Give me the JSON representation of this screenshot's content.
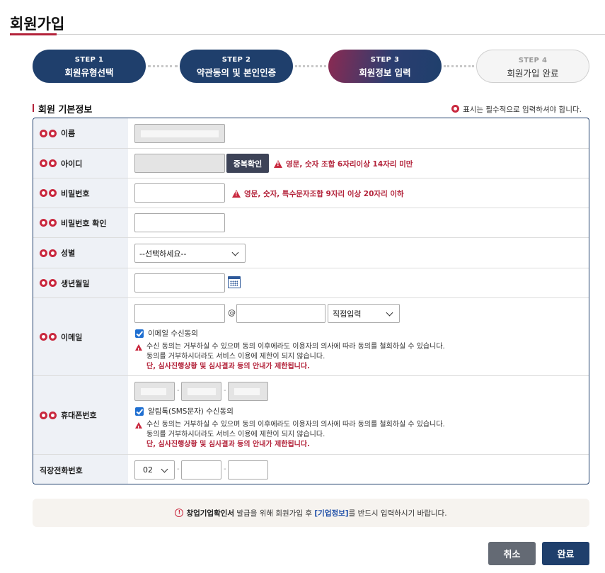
{
  "page": {
    "title": "회원가입"
  },
  "steps": [
    {
      "num": "STEP 1",
      "name": "회원유형선택"
    },
    {
      "num": "STEP 2",
      "name": "약관동의 및 본인인증"
    },
    {
      "num": "STEP 3",
      "name": "회원정보 입력"
    },
    {
      "num": "STEP 4",
      "name": "회원가입 완료"
    }
  ],
  "section": {
    "title": "회원 기본정보",
    "required_note": "표시는 필수적으로 입력하셔야 합니다."
  },
  "form": {
    "name_label": "이름",
    "id_label": "아이디",
    "id_check_button": "중복확인",
    "id_hint": "영문, 숫자 조합 6자리이상 14자리 미만",
    "password_label": "비밀번호",
    "password_hint": "영문, 숫자, 특수문자조합 9자리 이상 20자리 이하",
    "password_confirm_label": "비밀번호 확인",
    "gender_label": "성별",
    "gender_value": "--선택하세요--",
    "birth_label": "생년월일",
    "email_label": "이메일",
    "email_at": "@",
    "email_domain_select": "직접입력",
    "email_consent": "이메일 수신동의",
    "notice_line1": "수신 동의는 거부하실 수 있으며 동의 이후에라도 이용자의 의사에 따라 동의를 철회하실 수 있습니다.",
    "notice_line2": "동의를 거부하시더라도 서비스 이용에 제한이 되지 않습니다.",
    "notice_line3": "단, 심사진행상황 및 심사결과 등의 안내가 제한됩니다.",
    "phone_label": "휴대폰번호",
    "phone_dash": "-",
    "sms_consent": "알림톡(SMS문자) 수신동의",
    "work_phone_label": "직장전화번호",
    "work_phone_area": "02"
  },
  "info": {
    "emph": "창업기업확인서",
    "text1": " 발급을 위해 회원가입 후 ",
    "link": "[기업정보]",
    "text2": "를 반드시 입력하시기 바랍니다."
  },
  "buttons": {
    "cancel": "취소",
    "done": "완료"
  },
  "colors": {
    "navy": "#1f3f6c",
    "accent_red": "#c9283e",
    "gray_button": "#646a74"
  }
}
